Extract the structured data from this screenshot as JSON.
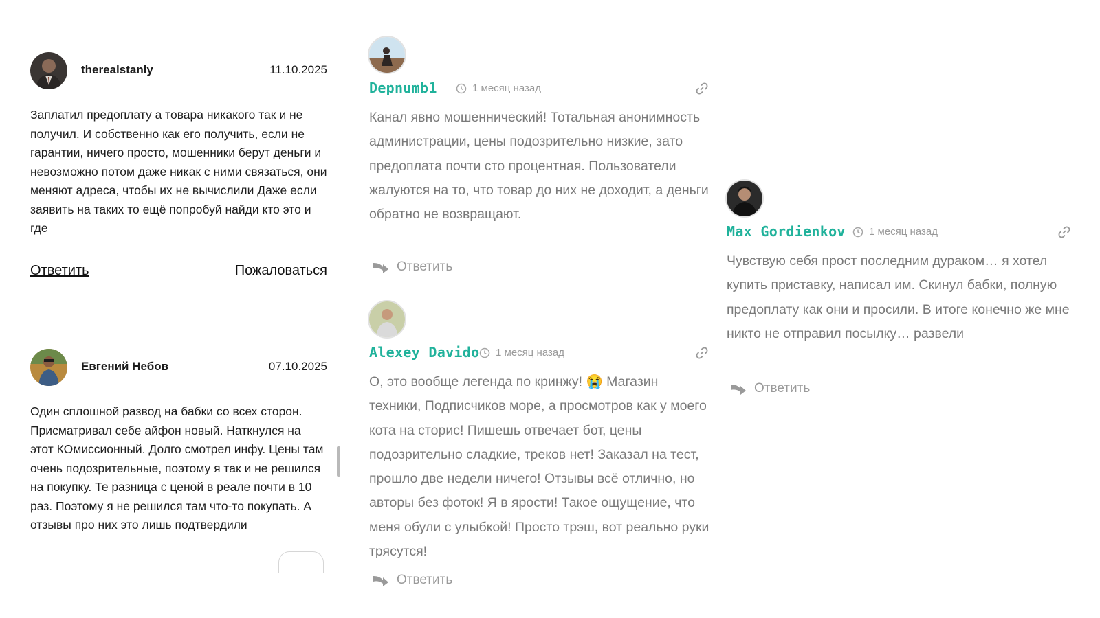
{
  "reviews": [
    {
      "author": "therealstanly",
      "date": "11.10.2025",
      "text": "Заплатил предоплату а товара никакого так и не получил. И собственно как его получить, если не гарантии, ничего просто, мошенники берут деньги и невозможно потом даже никак с ними связаться, они меняют адреса, чтобы их не вычислили Даже если заявить на таких то ещё попробуй найди кто это и где",
      "reply_label": "Ответить",
      "report_label": "Пожаловаться"
    },
    {
      "author": "Евгений Небов",
      "date": "07.10.2025",
      "text": "Один сплошной развод на бабки со всех сторон. Присматривал себе айфон новый. Наткнулся на этот КОмиссионный. Долго смотрел инфу. Цены там очень подозрительные, поэтому я так и не решился на покупку. Те разница с ценой в реале почти в 10 раз. Поэтому я не решился там что-то покупать. А отзывы про них это лишь подтвердили"
    }
  ],
  "comments": [
    {
      "name": "Depnumb1",
      "time": "1 месяц назад",
      "text": "Канал явно мошеннический! Тотальная анонимность администрации, цены подозрительно низкие, зато предоплата почти сто процентная. Пользователи жалуются на то, что товар до них не доходит, а деньги обратно не возвращают.",
      "reply_label": "Ответить"
    },
    {
      "name": "Alexey Davido",
      "time": "1 месяц назад",
      "text": "О, это вообще легенда по кринжу! 😭 Магазин техники, Подписчиков море, а просмотров как у моего кота на сторис! Пишешь отвечает бот, цены подозрительно сладкие, треков нет! Заказал на тест, прошло две недели ничего! Отзывы всё отлично, но авторы без фоток! Я в ярости! Такое ощущение, что меня обули с улыбкой! Просто трэш, вот реально руки трясутся!",
      "reply_label": "Ответить"
    },
    {
      "name": "Max Gordienkov",
      "time": "1 месяц назад",
      "text": "Чувствую себя прост последним дураком… я хотел купить приставку, написал им. Скинул бабки, полную предоплату как они и просили. В итоге конечно же мне никто не отправил посылку… развели",
      "reply_label": "Ответить"
    }
  ],
  "colors": {
    "accent": "#20b29b",
    "muted": "#7a7a7a",
    "meta": "#9a9a9a"
  },
  "icons": [
    "clock-icon",
    "link-icon",
    "reply-arrow-icon"
  ]
}
